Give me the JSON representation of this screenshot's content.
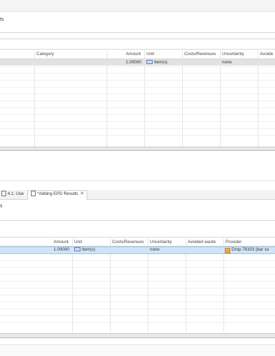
{
  "top_section": {
    "title_fragment": "ts",
    "columns": [
      "Category",
      "Amount",
      "Unit",
      "Costs/Revenues",
      "Uncertainty",
      "Avoide"
    ],
    "row": {
      "amount": "1.00000",
      "unit": "Item(s)",
      "uncertainty": "none"
    }
  },
  "tabs": [
    {
      "label": "4.1. Use",
      "icon": "process-box-icon",
      "closable": false
    },
    {
      "label": "*Adding EPD Results",
      "icon": "process-box-icon",
      "closable": true
    }
  ],
  "bottom_section": {
    "title_fragment": "s",
    "columns": [
      "Amount",
      "Unit",
      "Costs/Revenues",
      "Uncertainty",
      "Avoided waste",
      "Provider"
    ],
    "row": {
      "amount": "1.00000",
      "unit": "Item(s)",
      "uncertainty": "none",
      "provider": "Drop 79103 (bar so"
    }
  },
  "colors": {
    "selected_row_top": "#e2e2e2",
    "selected_row_bottom": "#cfe4f9",
    "grid": "#e4e4e4",
    "border": "#d6d6d6"
  }
}
